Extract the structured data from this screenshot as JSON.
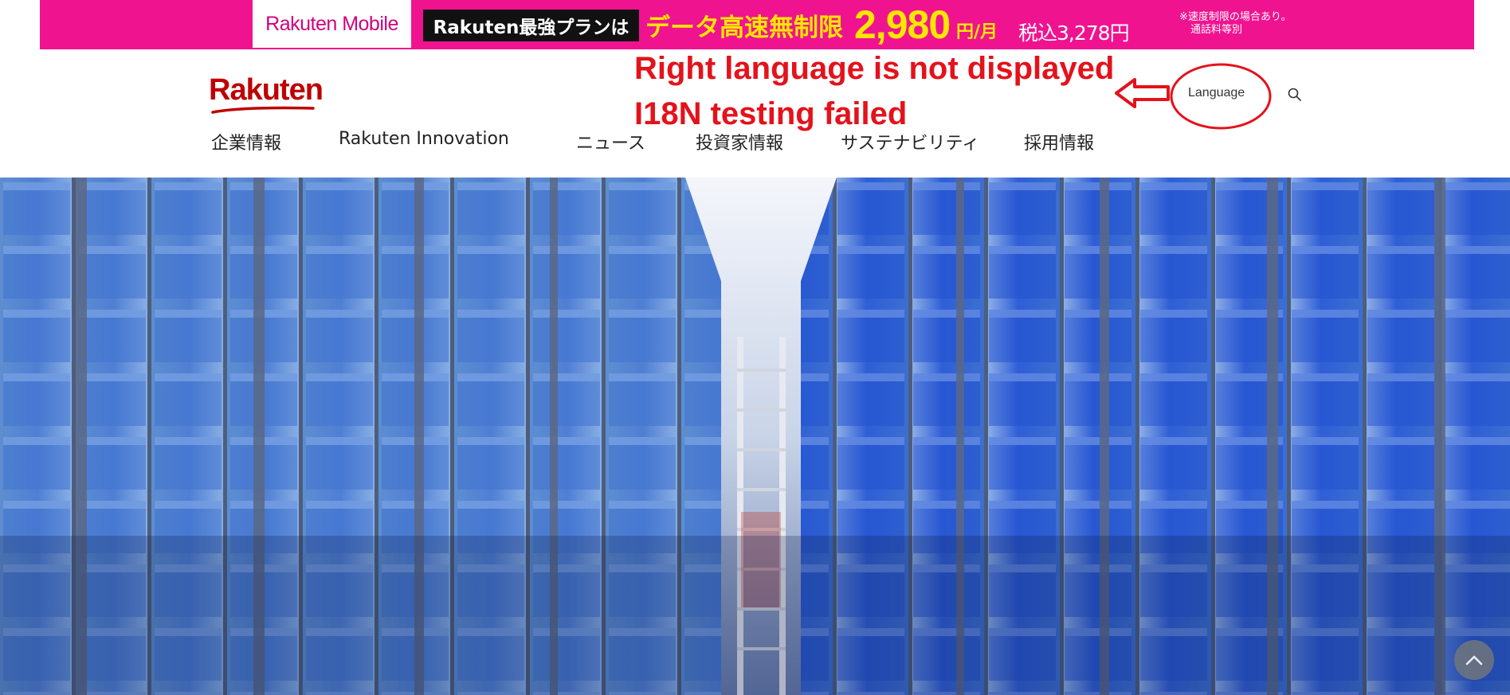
{
  "promo_banner": {
    "mobile_brand": "Rakuten Mobile",
    "plan_text": "Rakuten最強プランは",
    "unlimited_text": "データ高速無制限",
    "price": "2,980",
    "price_unit": "円/月",
    "tax_included": "税込3,278円",
    "note_line1": "※速度制限の場合あり。",
    "note_line2": "通話料等別",
    "colors": {
      "background": "#f0138f",
      "highlight": "#ffe600"
    }
  },
  "header": {
    "logo": "Rakuten",
    "language_label": "Language",
    "search_icon": "search-icon"
  },
  "annotation": {
    "line1": "Right language is not displayed",
    "line2": "I18N testing failed",
    "color": "#e4121b"
  },
  "nav": {
    "items": [
      {
        "label": "企業情報"
      },
      {
        "label": "Rakuten Innovation"
      },
      {
        "label": "ニュース"
      },
      {
        "label": "投資家情報"
      },
      {
        "label": "サステナビリティ"
      },
      {
        "label": "採用情報"
      }
    ]
  },
  "hero": {
    "scroll_top_icon": "chevron-up-icon"
  }
}
